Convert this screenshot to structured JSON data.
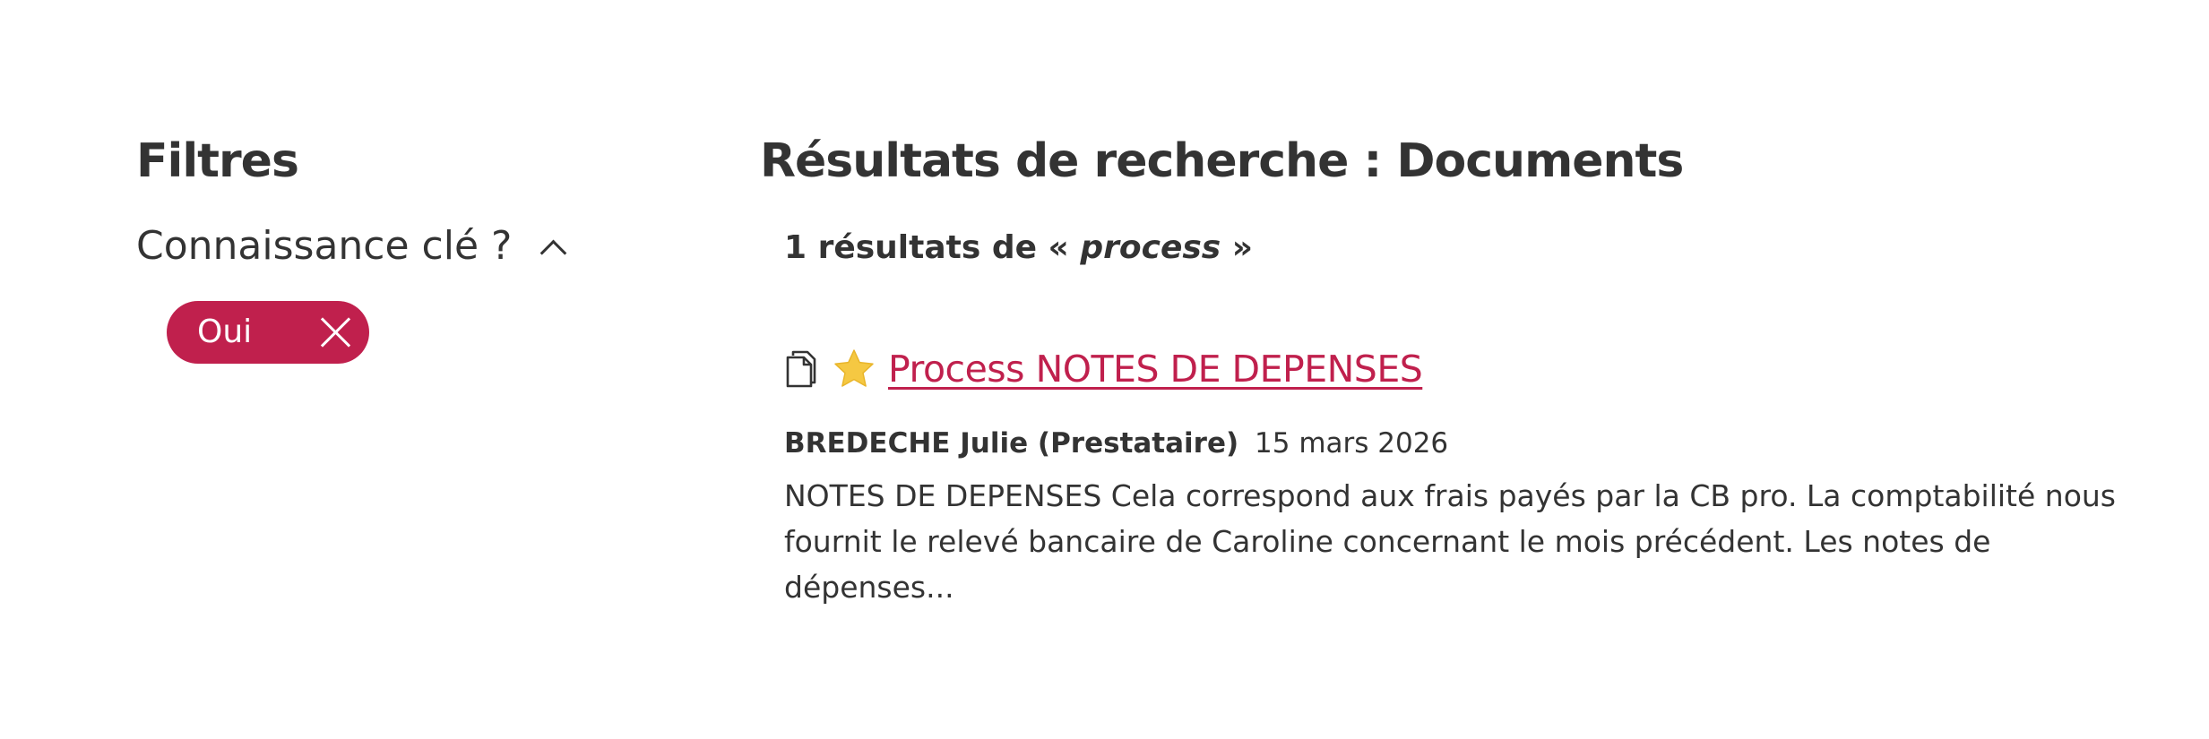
{
  "filters": {
    "title": "Filtres",
    "groups": [
      {
        "label": "Connaissance clé ?",
        "expanded": true,
        "selected": [
          {
            "label": "Oui"
          }
        ]
      }
    ]
  },
  "results": {
    "title": "Résultats de recherche : Documents",
    "count_prefix": "1 résultats de «",
    "query": "process",
    "count_suffix": "»",
    "items": [
      {
        "icons": [
          "document-icon",
          "star-icon"
        ],
        "title": "Process NOTES DE DEPENSES",
        "author": "BREDECHE Julie (Prestataire)",
        "date": "15 mars 2026",
        "snippet": "NOTES DE DEPENSES Cela correspond aux frais payés par la CB pro. La comptabilité nous fournit le relevé bancaire de Caroline concernant le mois précédent. Les notes de dépenses..."
      }
    ]
  },
  "colors": {
    "accent": "#c0204d",
    "text": "#333333",
    "star": "#f5c842"
  }
}
